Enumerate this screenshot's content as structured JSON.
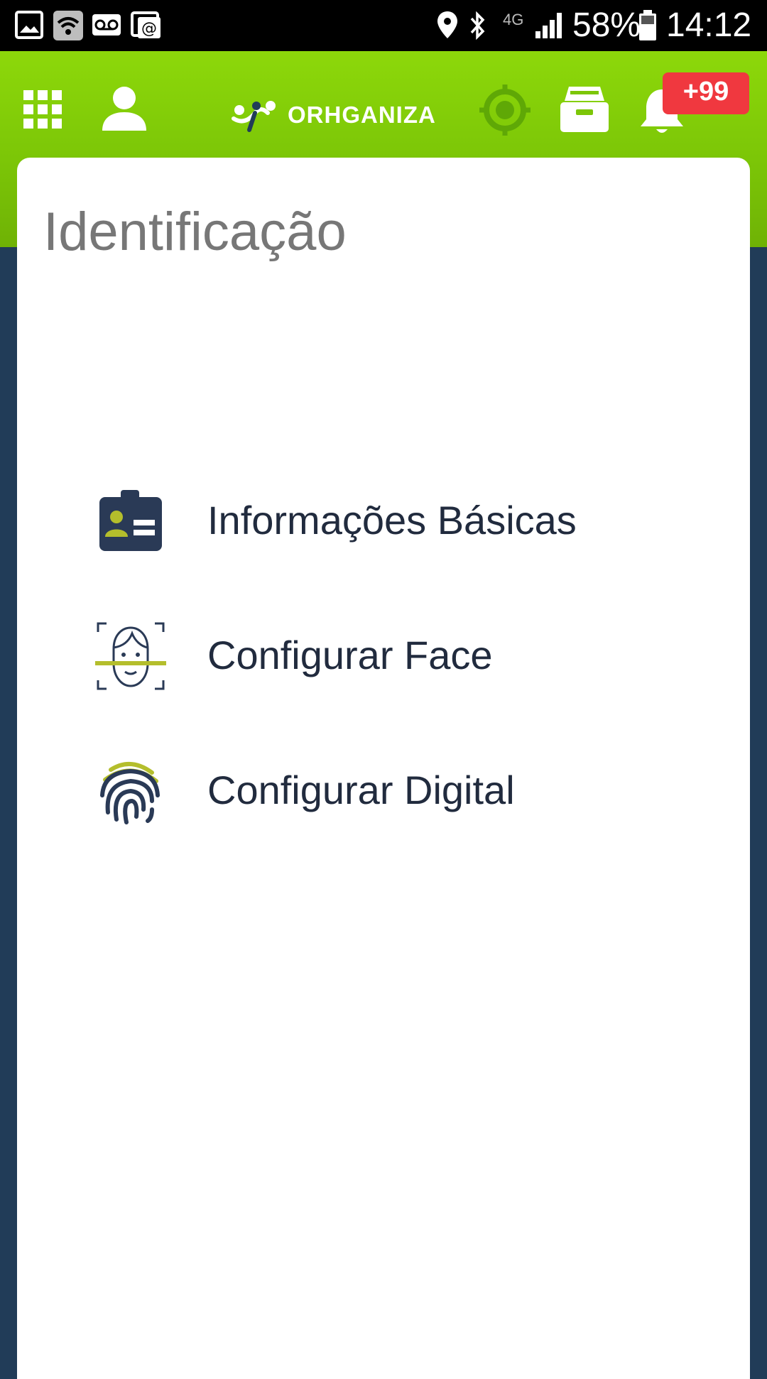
{
  "status_bar": {
    "battery": "58%",
    "time": "14:12",
    "network": "4G"
  },
  "app_bar": {
    "logo_text": "ORHGANIZA",
    "notification_badge": "+99",
    "icons": [
      "apps-grid-icon",
      "user-icon",
      "target-icon",
      "inbox-icon",
      "bell-icon"
    ],
    "colors": {
      "bar_green": "#8dd80a",
      "target_green": "#5fa806",
      "badge_red": "#f0383f"
    }
  },
  "page": {
    "title": "Identificação",
    "menu": [
      {
        "label": "Informações Básicas",
        "icon": "id-badge-icon"
      },
      {
        "label": "Configurar Face",
        "icon": "face-scan-icon"
      },
      {
        "label": "Configurar Digital",
        "icon": "fingerprint-icon"
      }
    ]
  },
  "colors": {
    "navy": "#213c58",
    "label": "#212b3e",
    "accent_olive": "#b4be2c"
  }
}
